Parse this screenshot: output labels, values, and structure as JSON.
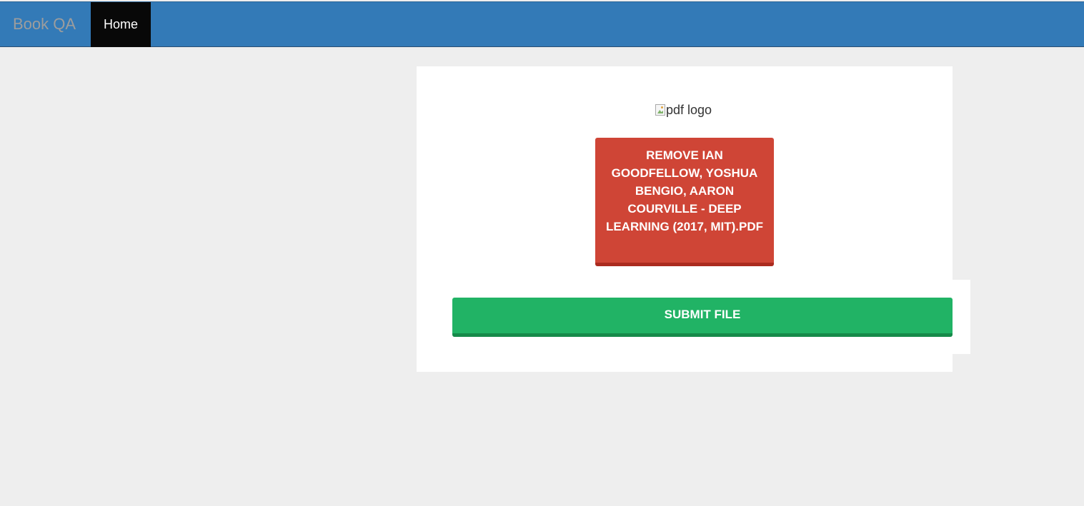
{
  "navbar": {
    "brand": "Book QA",
    "items": [
      {
        "label": "Home",
        "active": true
      }
    ],
    "colors": {
      "background": "#337ab7",
      "active_item": "#080808"
    }
  },
  "upload_card": {
    "logo_alt": "pdf logo",
    "remove_button_label": "REMOVE IAN GOODFELLOW, YOSHUA BENGIO, AARON COURVILLE - DEEP LEARNING (2017, MIT).PDF",
    "submit_button_label": "SUBMIT FILE",
    "colors": {
      "remove_button": "#cf4536",
      "submit_button": "#21b365"
    }
  },
  "icons": {
    "logo": "broken-image-icon"
  }
}
